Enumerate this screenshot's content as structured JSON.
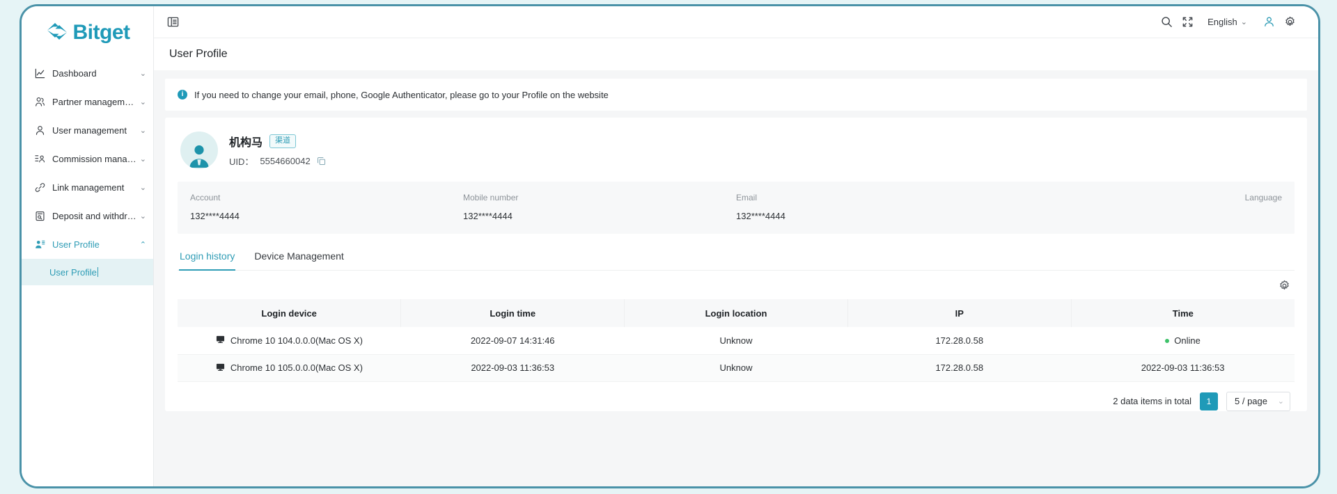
{
  "brand": {
    "name": "Bitget",
    "logo_icon": "bitget-logo-icon"
  },
  "sidebar": {
    "items": [
      {
        "label": "Dashboard",
        "icon": "chart-line-icon",
        "chevron": "chevron-down-icon"
      },
      {
        "label": "Partner management",
        "icon": "partner-users-icon",
        "chevron": "chevron-down-icon"
      },
      {
        "label": "User management",
        "icon": "user-icon",
        "chevron": "chevron-down-icon"
      },
      {
        "label": "Commission management",
        "icon": "commission-list-user-icon",
        "chevron": "chevron-down-icon"
      },
      {
        "label": "Link management",
        "icon": "link-chain-icon",
        "chevron": "chevron-down-icon"
      },
      {
        "label": "Deposit and withdrawal i...",
        "icon": "document-search-icon",
        "chevron": "chevron-down-icon"
      },
      {
        "label": "User Profile",
        "icon": "user-settings-icon",
        "chevron": "chevron-up-icon",
        "active": true
      }
    ],
    "submenu": {
      "label": "User Profile"
    }
  },
  "topbar": {
    "menu_fold_icon": "menu-fold-icon",
    "search_icon": "search-icon",
    "fullscreen_icon": "fullscreen-icon",
    "language": "English",
    "language_chevron": "chevron-down-icon",
    "account_icon": "account-user-icon",
    "settings_icon": "gear-icon"
  },
  "page": {
    "title": "User Profile"
  },
  "alert": {
    "icon": "info-circle-icon",
    "mark": "i",
    "text": "If you need to change your email, phone, Google Authenticator, please go to your Profile on the website"
  },
  "profile": {
    "avatar_icon": "avatar-person-icon",
    "name": "机构马",
    "badge": "渠道",
    "uid_label": "UID：",
    "uid_value": "5554660042",
    "copy_icon": "copy-icon",
    "fields": [
      {
        "label": "Account",
        "value": "132****4444"
      },
      {
        "label": "Mobile number",
        "value": "132****4444"
      },
      {
        "label": "Email",
        "value": "132****4444"
      },
      {
        "label": "Language",
        "value": ""
      }
    ]
  },
  "tabs": [
    {
      "label": "Login history",
      "active": true
    },
    {
      "label": "Device Management",
      "active": false
    }
  ],
  "table": {
    "settings_icon": "gear-icon",
    "columns": [
      "Login device",
      "Login time",
      "Login location",
      "IP",
      "Time"
    ],
    "rows": [
      {
        "device_icon": "monitor-icon",
        "device": "Chrome 10 104.0.0.0(Mac OS X)",
        "login_time": "2022-09-07 14:31:46",
        "location": "Unknow",
        "ip": "172.28.0.58",
        "time": "Online",
        "online": true
      },
      {
        "device_icon": "monitor-icon",
        "device": "Chrome 10 105.0.0.0(Mac OS X)",
        "login_time": "2022-09-03 11:36:53",
        "location": "Unknow",
        "ip": "172.28.0.58",
        "time": "2022-09-03 11:36:53",
        "online": false
      }
    ]
  },
  "pagination": {
    "total_text": "2 data items in total",
    "current_page": "1",
    "page_size": "5 / page",
    "chevron": "chevron-down-icon"
  },
  "colors": {
    "brand_teal": "#1f9ab8",
    "frame_border": "#4a92a8",
    "active_teal": "#2e9cb5",
    "online_green": "#3ec26a",
    "page_bg": "#e6f4f6"
  }
}
